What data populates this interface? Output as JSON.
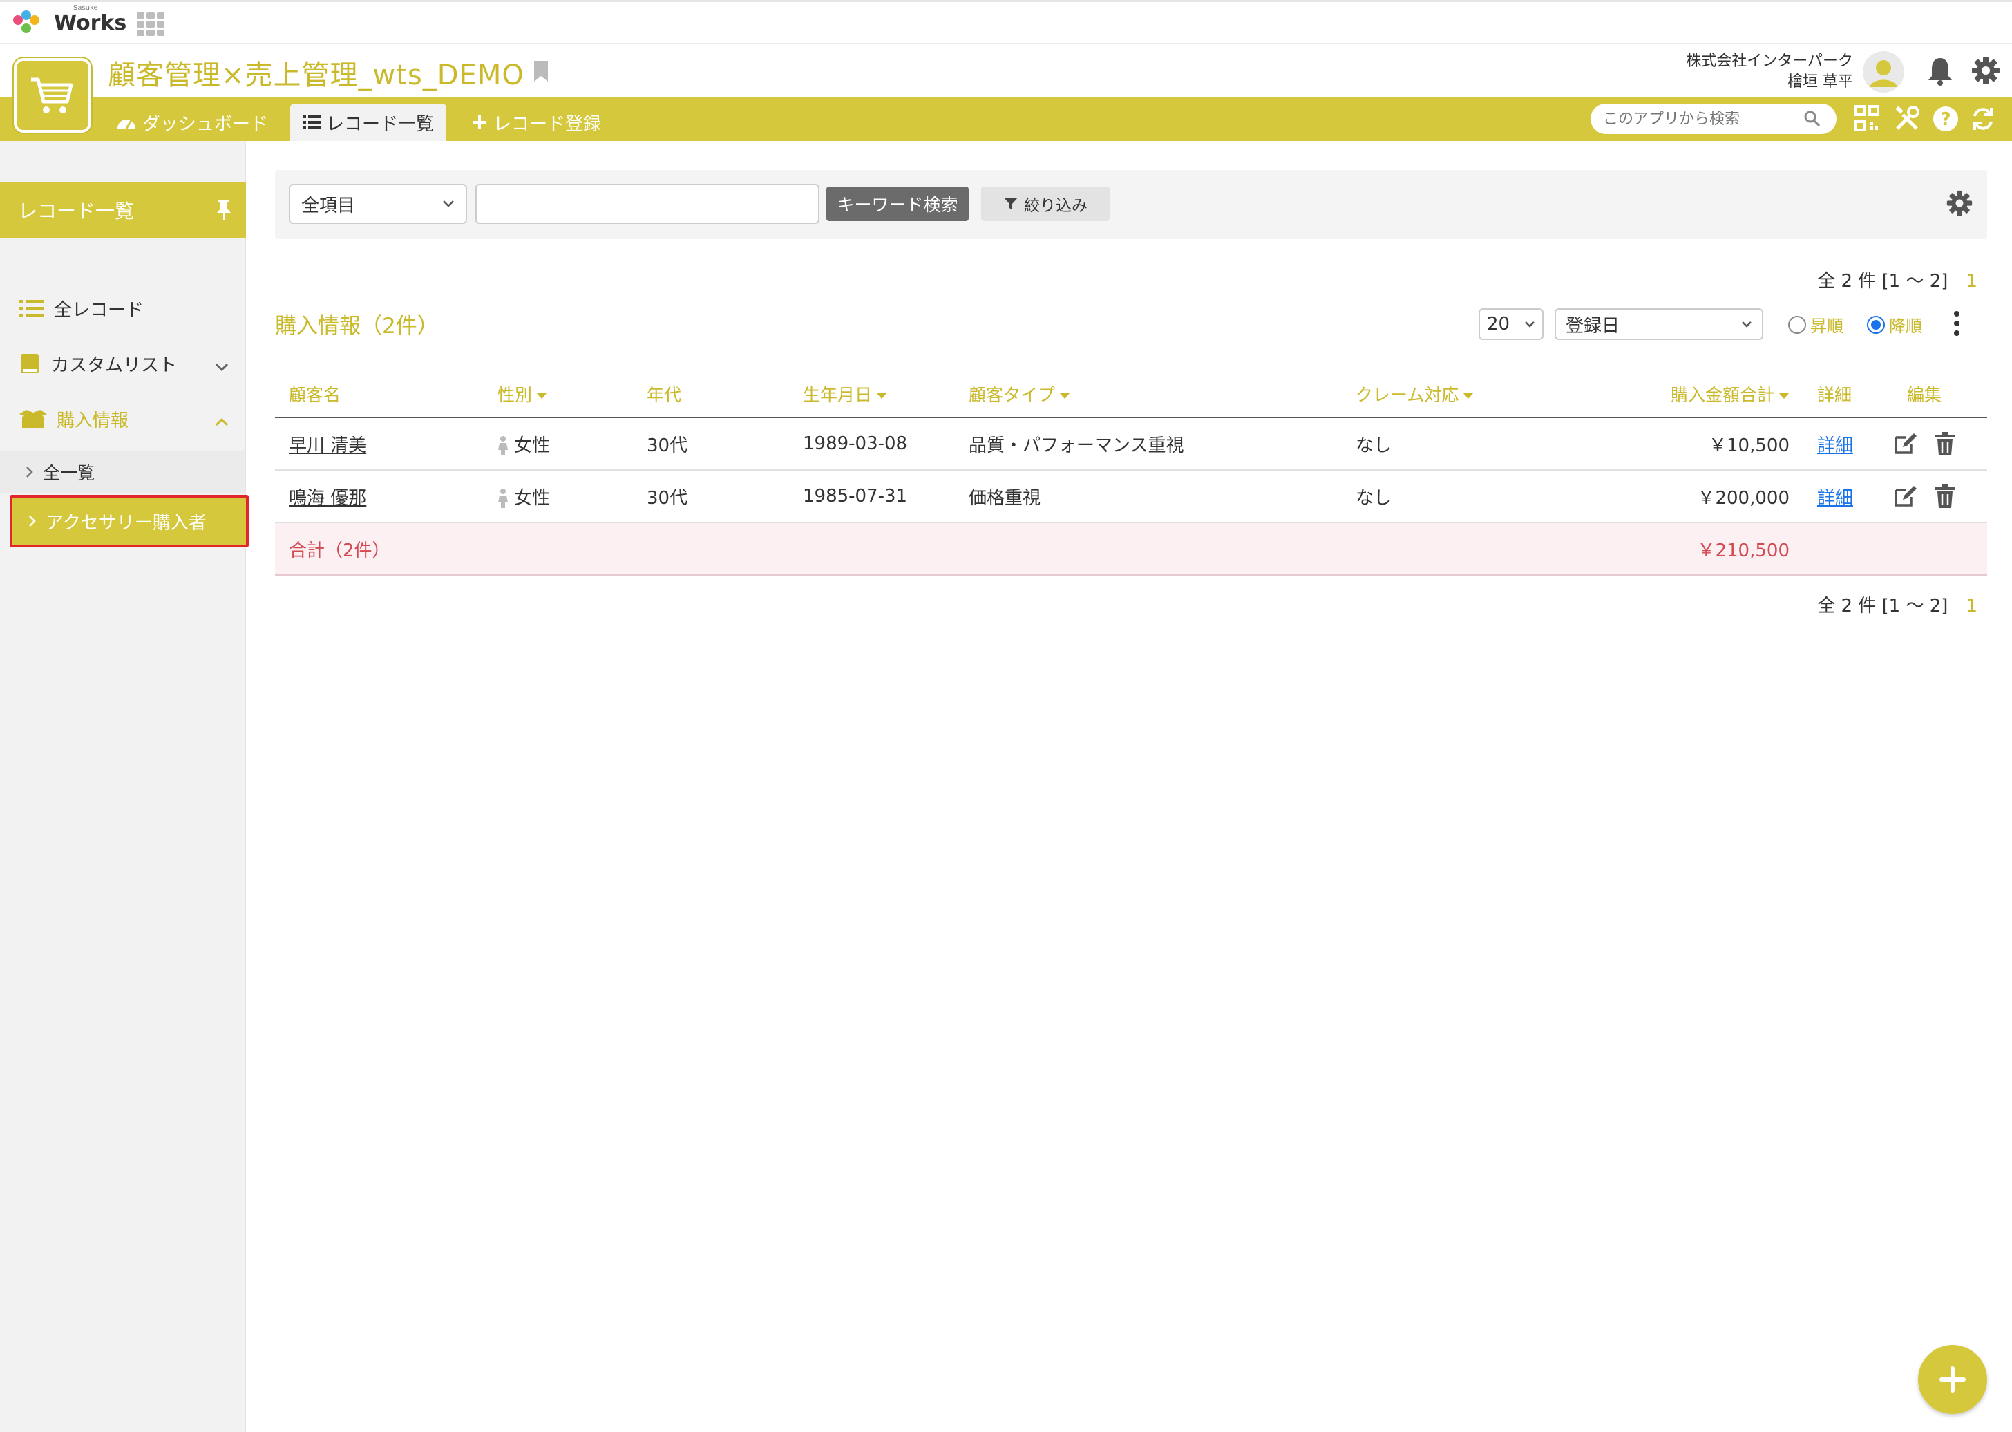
{
  "brand": {
    "name": "Works",
    "sub": "Sasuke"
  },
  "header": {
    "app_title": "顧客管理×売上管理_wts_DEMO",
    "company": "株式会社インターパーク",
    "user": "檜垣 草平"
  },
  "nav": {
    "dashboard": "ダッシュボード",
    "record_list": "レコード一覧",
    "record_register": "レコード登録"
  },
  "search": {
    "placeholder": "このアプリから検索"
  },
  "sidebar": {
    "heading": "レコード一覧",
    "all_records": "全レコード",
    "custom_list": "カスタムリスト",
    "purchase_info": "購入情報",
    "sub_all": "全一覧",
    "sub_accessory": "アクセサリー購入者"
  },
  "filter": {
    "field_select": "全項目",
    "keyword_button": "キーワード検索",
    "narrow_button": "絞り込み"
  },
  "list": {
    "count_text": "全 2 件 [1 〜 2]",
    "page": "1",
    "title": "購入情報（2件）",
    "per_page": "20",
    "sort_field": "登録日",
    "asc": "昇順",
    "desc": "降順"
  },
  "table": {
    "headers": {
      "name": "顧客名",
      "gender": "性別",
      "age": "年代",
      "birthday": "生年月日",
      "type": "顧客タイプ",
      "claim": "クレーム対応",
      "total": "購入金額合計",
      "detail": "詳細",
      "edit": "編集"
    },
    "rows": [
      {
        "name": "早川 清美",
        "gender": "女性",
        "age": "30代",
        "birthday": "1989-03-08",
        "type": "品質・パフォーマンス重視",
        "claim": "なし",
        "total": "￥10,500",
        "detail": "詳細"
      },
      {
        "name": "鳴海 優那",
        "gender": "女性",
        "age": "30代",
        "birthday": "1985-07-31",
        "type": "価格重視",
        "claim": "なし",
        "total": "￥200,000",
        "detail": "詳細"
      }
    ],
    "summary": {
      "label": "合計（2件）",
      "total": "￥210,500"
    }
  },
  "colors": {
    "accent": "#d6c83c",
    "accent_text": "#c9b92b",
    "highlight_border": "#e3262a",
    "total_text": "#d24b52"
  }
}
